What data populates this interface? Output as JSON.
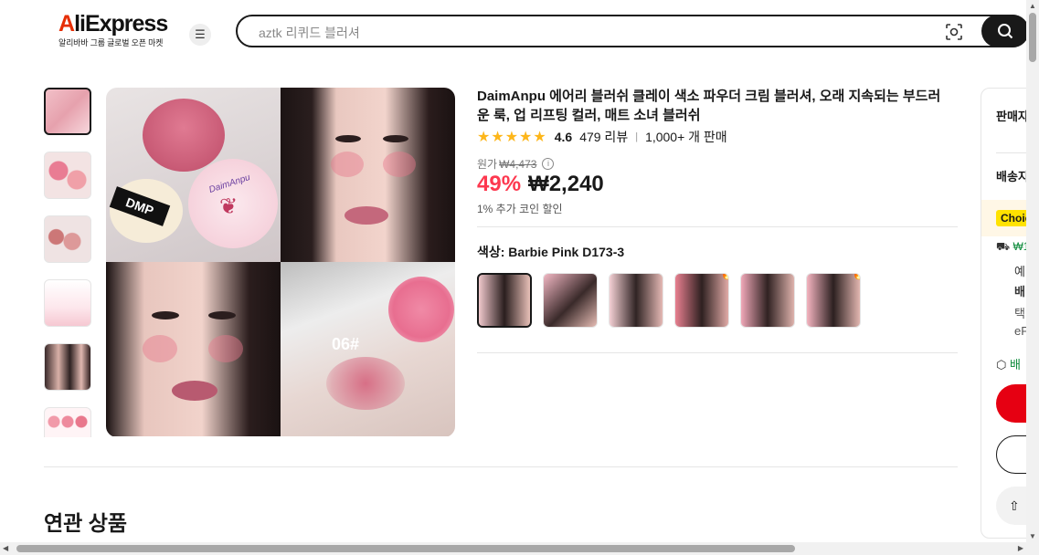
{
  "header": {
    "logo_text": "AliExpress",
    "logo_subtitle": "알리바바 그룹 글로벌 오픈 마켓",
    "search_placeholder": "aztk 리퀴드 블러셔"
  },
  "product": {
    "title": "DaimAnpu 에어리 블러쉬 클레이 색소 파우더 크림 블러셔, 오래 지속되는 부드러운 룩, 업 리프팅 컬러, 매트 소녀 블러쉬",
    "rating": "4.6",
    "rating_fraction": 0.92,
    "reviews": "479 리뷰",
    "sold": "1,000+ 개 판매",
    "original_label": "원가",
    "original_price": "₩4,473",
    "discount": "49%",
    "price": "₩2,240",
    "coin_note": "1% 추가 코인 할인",
    "color_label": "색상: Barbie Pink D173-3",
    "main_image_label": "06#",
    "main_image_box_label": "DMP",
    "main_image_jar_label": "DaimAnpu"
  },
  "thumbnails": [
    {
      "name": "thumb-1",
      "hot": false
    },
    {
      "name": "thumb-2",
      "hot": false
    },
    {
      "name": "thumb-3",
      "hot": false
    },
    {
      "name": "thumb-4",
      "hot": false
    },
    {
      "name": "thumb-5",
      "hot": false
    },
    {
      "name": "thumb-6",
      "hot": false
    }
  ],
  "swatches_hot": [
    false,
    false,
    false,
    true,
    false,
    true
  ],
  "related_heading": "연관 상품",
  "side_panel": {
    "seller": "판매자",
    "shipping": "배송지",
    "choice": "Choice",
    "free": "₩1",
    "line1": "예",
    "line2": "배",
    "line3": "택",
    "line4": "eP",
    "box_text": "배",
    "share_icon": "share-icon"
  },
  "colors": {
    "accent": "#fd384f",
    "brand": "#e62e04",
    "buy": "#e60012",
    "star": "#fdb61a",
    "choice": "#ffe200"
  }
}
